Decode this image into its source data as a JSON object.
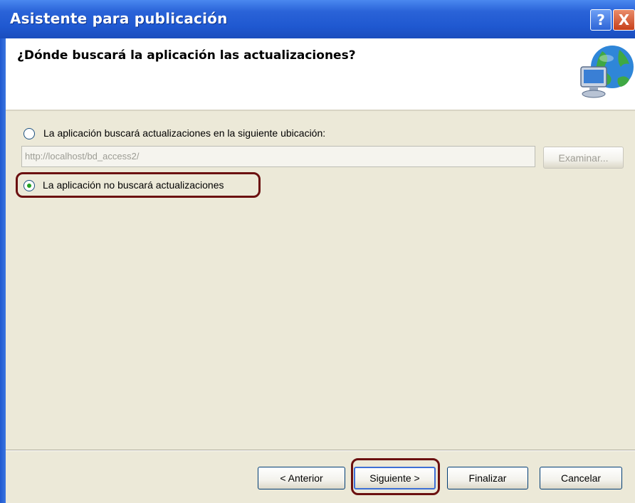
{
  "window": {
    "title": "Asistente para publicación",
    "help_button": "?",
    "close_button": "X"
  },
  "header": {
    "question": "¿Dónde buscará la aplicación las actualizaciones?",
    "icon": "globe-computer-icon"
  },
  "options": {
    "check_location": {
      "label": "La aplicación buscará actualizaciones en la siguiente ubicación:",
      "selected": false
    },
    "url_value": "http://localhost/bd_access2/",
    "browse_label": "Examinar...",
    "no_updates": {
      "label": "La aplicación no buscará actualizaciones",
      "selected": true
    }
  },
  "buttons": {
    "back": "< Anterior",
    "next": "Siguiente >",
    "finish": "Finalizar",
    "cancel": "Cancelar"
  },
  "colors": {
    "titlebar": "#2a63d8",
    "dialog_bg": "#ece9d8",
    "highlight_ring": "#6b1010",
    "radio_dot": "#21a121"
  }
}
